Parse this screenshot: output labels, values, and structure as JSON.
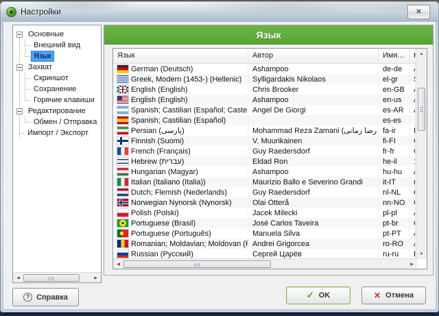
{
  "window": {
    "title": "Настройки"
  },
  "icons": {
    "close": "✕",
    "help": "?",
    "ok_check": "✓",
    "cancel_x": "✕",
    "scroll_up": "▲",
    "scroll_down": "▼",
    "scroll_left": "◀",
    "scroll_right": "▶"
  },
  "tree": {
    "items": [
      {
        "label": "Основные",
        "type": "parent",
        "expanded": true
      },
      {
        "label": "Внешний вид",
        "type": "child"
      },
      {
        "label": "Язык",
        "type": "child",
        "selected": true,
        "last": true
      },
      {
        "label": "Захват",
        "type": "parent",
        "expanded": true
      },
      {
        "label": "Скриншот",
        "type": "child"
      },
      {
        "label": "Сохранение",
        "type": "child"
      },
      {
        "label": "Горячие клавиши",
        "type": "child",
        "last": true
      },
      {
        "label": "Редактирование",
        "type": "parent",
        "expanded": true
      },
      {
        "label": "Обмен / Отправка",
        "type": "child",
        "last": true
      },
      {
        "label": "Импорт / Экспорт",
        "type": "root"
      }
    ]
  },
  "panel": {
    "title": "Язык"
  },
  "table": {
    "columns": [
      "Язык",
      "Автор",
      "Имя...",
      "К"
    ],
    "rows": [
      {
        "flag": "de",
        "language": "German (Deutsch)",
        "author": "Ashampoo",
        "name": "de-de",
        "k": "A"
      },
      {
        "flag": "gr",
        "language": "Greek, Modern (1453-) (Hellenic)",
        "author": "Sylligardakis Nikolaos",
        "name": "el-gr",
        "k": "S"
      },
      {
        "flag": "gb",
        "language": "English (English)",
        "author": "Chris Brooker",
        "name": "en-GB",
        "k": "A"
      },
      {
        "flag": "us",
        "language": "English (English)",
        "author": "Ashampoo",
        "name": "en-us",
        "k": "A"
      },
      {
        "flag": "ar",
        "language": "Spanish; Castilian (Español; Castellano)",
        "author": "Angel De Giorgi",
        "name": "es-AR",
        "k": "A"
      },
      {
        "flag": "es",
        "language": "Spanish; Castilian (Español)",
        "author": "",
        "name": "es-es",
        "k": ""
      },
      {
        "flag": "ir",
        "language": "Persian (پارسی)",
        "author": "Mohammad Reza Zamani (محمد رضا زمانی)",
        "name": "fa-ir",
        "k": "I"
      },
      {
        "flag": "fi",
        "language": "Finnish (Suomi)",
        "author": "V. Muurikainen",
        "name": "fi-FI",
        "k": "C"
      },
      {
        "flag": "fr",
        "language": "French (Français)",
        "author": "Guy Raedersdorf",
        "name": "fr-fr",
        "k": "C"
      },
      {
        "flag": "il",
        "language": "Hebrew (עברית)",
        "author": "Eldad Ron",
        "name": "he-il",
        "k": "1"
      },
      {
        "flag": "hu",
        "language": "Hungarian (Magyar)",
        "author": "Ashampoo",
        "name": "hu-hu",
        "k": "A"
      },
      {
        "flag": "it",
        "language": "Italian (Italiano (Italia))",
        "author": "Maurizio Ballo e Severino Grandi",
        "name": "it-IT",
        "k": "r"
      },
      {
        "flag": "nl",
        "language": "Dutch; Flemish (Nederlands)",
        "author": "Guy Raedersdorf",
        "name": "nl-NL",
        "k": "C"
      },
      {
        "flag": "no",
        "language": "Norwegian Nynorsk (Nynorsk)",
        "author": "Olai Otterå",
        "name": "nn-NO",
        "k": "C"
      },
      {
        "flag": "pl",
        "language": "Polish (Polski)",
        "author": "Jacek Milecki",
        "name": "pl-pl",
        "k": "A"
      },
      {
        "flag": "br",
        "language": "Portuguese (Brasil)",
        "author": "José Carlos Taveira",
        "name": "pt-br",
        "k": "C"
      },
      {
        "flag": "pt",
        "language": "Portuguese (Português)",
        "author": "Manuela Silva",
        "name": "pt-PT",
        "k": "A"
      },
      {
        "flag": "ro",
        "language": "Romanian; Moldavian; Moldovan (Română)",
        "author": "Andrei Grigorcea",
        "name": "ro-RO",
        "k": "A"
      },
      {
        "flag": "ru",
        "language": "Russian (Русский)",
        "author": "Сергей Царёв",
        "name": "ru-ru",
        "k": "Г"
      }
    ]
  },
  "buttons": {
    "help": "Справка",
    "ok": "OK",
    "cancel": "Отмена"
  },
  "colors": {
    "accent_green": "#5aa83a",
    "selection_blue": "#4da3f7",
    "ok_border_green": "#83b441",
    "cancel_x_red": "#cc2a2a",
    "dialog_bg": "#f0f0f0"
  }
}
